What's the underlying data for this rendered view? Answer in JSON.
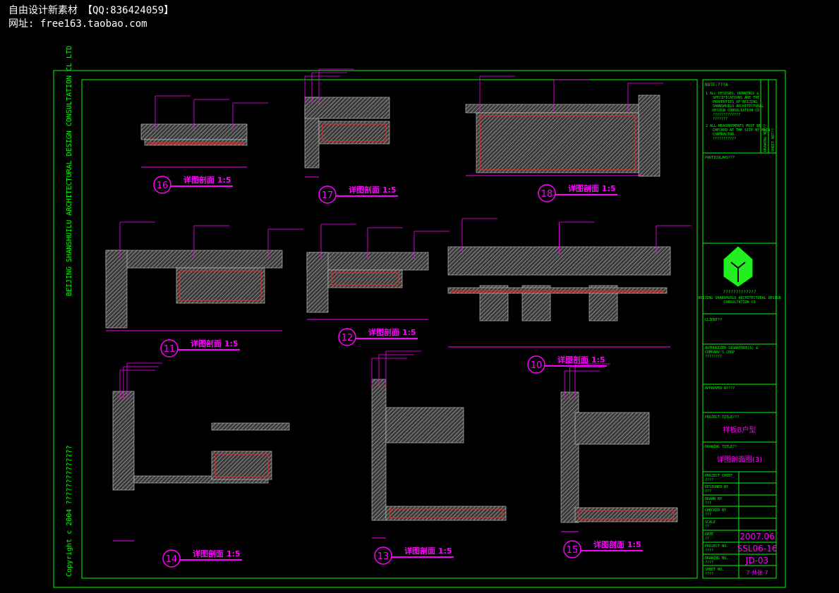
{
  "watermark": {
    "line1": "自由设计新素材　【QQ:836424059】",
    "line2": "网址: free163.taobao.com"
  },
  "side_text": {
    "company": "BEIJING SHANSHUILU ARCHITECTURAL DESIGN CONSULTATION CL LTD",
    "copyright": "Copyright c 2004 ??????????????"
  },
  "details": [
    {
      "num": "16",
      "title": "详图剖面 1:5"
    },
    {
      "num": "17",
      "title": "详图剖面 1:5"
    },
    {
      "num": "18",
      "title": "详图剖面 1:5"
    },
    {
      "num": "11",
      "title": "详图剖面 1:5"
    },
    {
      "num": "12",
      "title": "详图剖面 1:5"
    },
    {
      "num": "10",
      "title": "详图剖面 1:5"
    },
    {
      "num": "14",
      "title": "详图剖面 1:5"
    },
    {
      "num": "13",
      "title": "详图剖面 1:5"
    },
    {
      "num": "15",
      "title": "详图剖面 1:5"
    }
  ],
  "title_block": {
    "note_title": "NOTE:???A",
    "note1": [
      "1 ALL DESIGNS, DRAWINGS &",
      "SPECIFICATIONS ARE THE",
      "PROPERTIES OF BEIJING",
      "SHANSHUILU ARCHITECTURAL",
      "DESIGN CONSULTATION CO",
      "?????????????",
      "???????"
    ],
    "note2": [
      "2 ALL MEASUREMENTS MUST BE",
      "CHECKED AT THE SITE BY MAIN",
      "CONTRACTOR.",
      "???????????"
    ],
    "drawing_no_v": "DRAWING NO???",
    "sheet_no_v": "SHEET NO???",
    "particulars": "PARTICULARS???",
    "logo_cn": "?????????????",
    "logo_en1": "BEIJING SHANSHUILU ARCHITECTURAL DESIGN",
    "logo_en2": "CONSULTATION  CO",
    "client": "CLIENT??",
    "authorized": [
      "AUTHORIZED SIGNATURE(S) &",
      "COMPANY'S CHOP",
      "????????"
    ],
    "approved": "APPROVED BY???",
    "project_title_label": "PROJECT TITLE???",
    "project_title": "样板B户型",
    "drawing_title_label": "DRAWING TITLE??",
    "drawing_title": "详图剖面图(3)",
    "rows": [
      {
        "label": "PROJECT CHIEF",
        "sub": "????",
        "value": ""
      },
      {
        "label": "DESIGNED BY",
        "sub": "???",
        "value": ""
      },
      {
        "label": "DRAWN BY",
        "sub": "???",
        "value": ""
      },
      {
        "label": "CHECKED BY",
        "sub": "???",
        "value": ""
      },
      {
        "label": "SCALE",
        "sub": "??",
        "value": ""
      },
      {
        "label": "DATE",
        "sub": "??",
        "value": "2007.06"
      },
      {
        "label": "PROJECT NO.",
        "sub": "????",
        "value": "SSL06-16"
      },
      {
        "label": "DRAWING NO.",
        "sub": "????",
        "value": "JD-03"
      },
      {
        "label": "SHEET NO.",
        "sub": "????",
        "value": "7 共张 7"
      }
    ]
  },
  "colors": {
    "frame": "#00ff00",
    "annotation": "#ff00ff",
    "section": "#ff0000",
    "hatch": "#9a9a9a",
    "dim": "#00ffff"
  }
}
